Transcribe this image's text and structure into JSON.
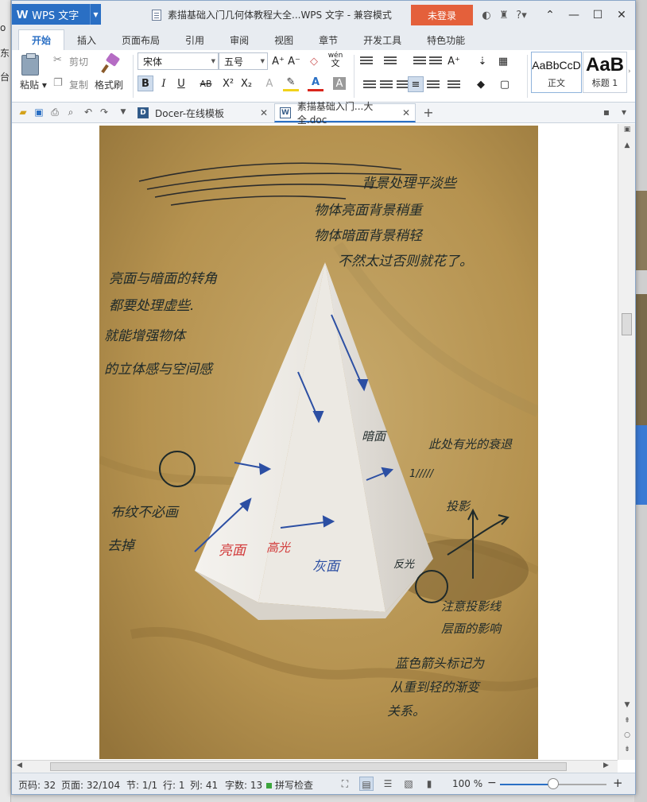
{
  "title_bar": {
    "app_name": "WPS 文字",
    "app_logo": "W",
    "document_title": "素描基础入门几何体教程大全...WPS 文字 - 兼容模式",
    "login_button": "未登录",
    "icons": [
      "cloud-icon",
      "shirt-icon",
      "help-icon"
    ],
    "help_label": "?"
  },
  "ribbon_tabs": [
    "开始",
    "插入",
    "页面布局",
    "引用",
    "审阅",
    "视图",
    "章节",
    "开发工具",
    "特色功能"
  ],
  "ribbon": {
    "paste": "粘贴",
    "cut": "剪切",
    "copy": "复制",
    "format_painter": "格式刷",
    "font_name": "宋体",
    "font_size": "五号",
    "bold": "B",
    "italic": "I",
    "underline": "U",
    "strikethrough": "AB",
    "superscript": "X²",
    "subscript": "X₂",
    "grow_font": "A⁺",
    "shrink_font": "A⁻",
    "phonetic": "wén",
    "phonetic_char": "文",
    "styles": [
      {
        "preview": "AaBbCcD",
        "name": "正文"
      },
      {
        "preview": "AaB",
        "name": "标题 1"
      }
    ]
  },
  "doc_tabs": [
    {
      "label": "Docer-在线模板",
      "icon": "D"
    },
    {
      "label": "素描基础入门...大全.doc",
      "icon": "W"
    }
  ],
  "photo_annotations": {
    "background_note": [
      "背景处理平淡些",
      "物体亮面背景稍重",
      "物体暗面背景稍轻",
      "不然太过否则就花了。"
    ],
    "edge_note": [
      "亮面与暗面的转角",
      "都要处理虚些.",
      "就能增强物体",
      "的立体感与空间感"
    ],
    "shadow_label": "暗面",
    "reflect_note": "此处有光的衰退",
    "hatch_label": "1/////",
    "cloth_note": [
      "布纹不必画",
      "去掉"
    ],
    "projection_label": "投影",
    "highlight_side": "亮面",
    "highlight_center": "高光",
    "gray_side": "灰面",
    "reflected": "反光",
    "cast_shadow_note": [
      "注意投影线",
      "层面的影响"
    ],
    "blue_note": [
      "蓝色箭头标记为",
      "从重到轻的渐变",
      "关系。"
    ]
  },
  "status_bar": {
    "page_code": "页码: 32",
    "page": "页面: 32/104",
    "section": "节: 1/1",
    "row": "行: 1",
    "col": "列: 41",
    "word_count": "字数: 13",
    "spell_check": "拼写检查",
    "zoom": "100 %",
    "zoom_fraction": 0.5
  },
  "colors": {
    "accent": "#2a6fc4",
    "login": "#e4603b",
    "ink_dark": "#1f2a2a",
    "ink_blue": "#2c4fa3",
    "ink_red": "#d23a3a"
  }
}
